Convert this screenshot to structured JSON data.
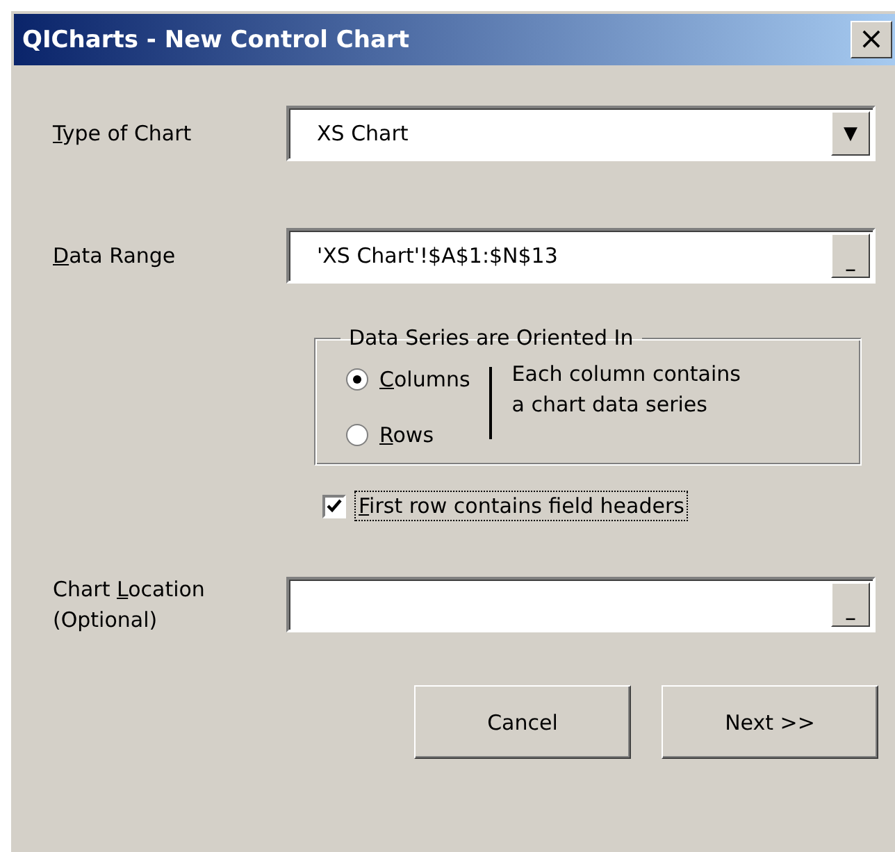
{
  "window": {
    "title": "QICharts - New Control Chart",
    "close": "×"
  },
  "type_of_chart": {
    "label": {
      "access_key": "T",
      "after": "ype of Chart"
    },
    "value": "XS Chart",
    "button": "▼"
  },
  "data_range": {
    "label": {
      "access_key": "D",
      "after": "ata Range"
    },
    "value": "'XS Chart'!$A$1:$N$13",
    "button": "_"
  },
  "orientation": {
    "title": "Data Series are Oriented In",
    "options": [
      {
        "label": {
          "access_key": "C",
          "after": "olumns"
        },
        "selected": true
      },
      {
        "label": {
          "access_key": "R",
          "after": "ows"
        },
        "selected": false
      }
    ],
    "note": "Each column contains a chart data series"
  },
  "headers_checkbox": {
    "label": {
      "access_key": "F",
      "after": "irst row contains field headers"
    },
    "checked": true,
    "focused": true
  },
  "chart_location": {
    "label": {
      "before": "Chart ",
      "access_key": "L",
      "after": "ocation"
    },
    "sublabel": "(Optional)",
    "button": "_"
  },
  "buttons": [
    "Cancel",
    "Next >>"
  ]
}
